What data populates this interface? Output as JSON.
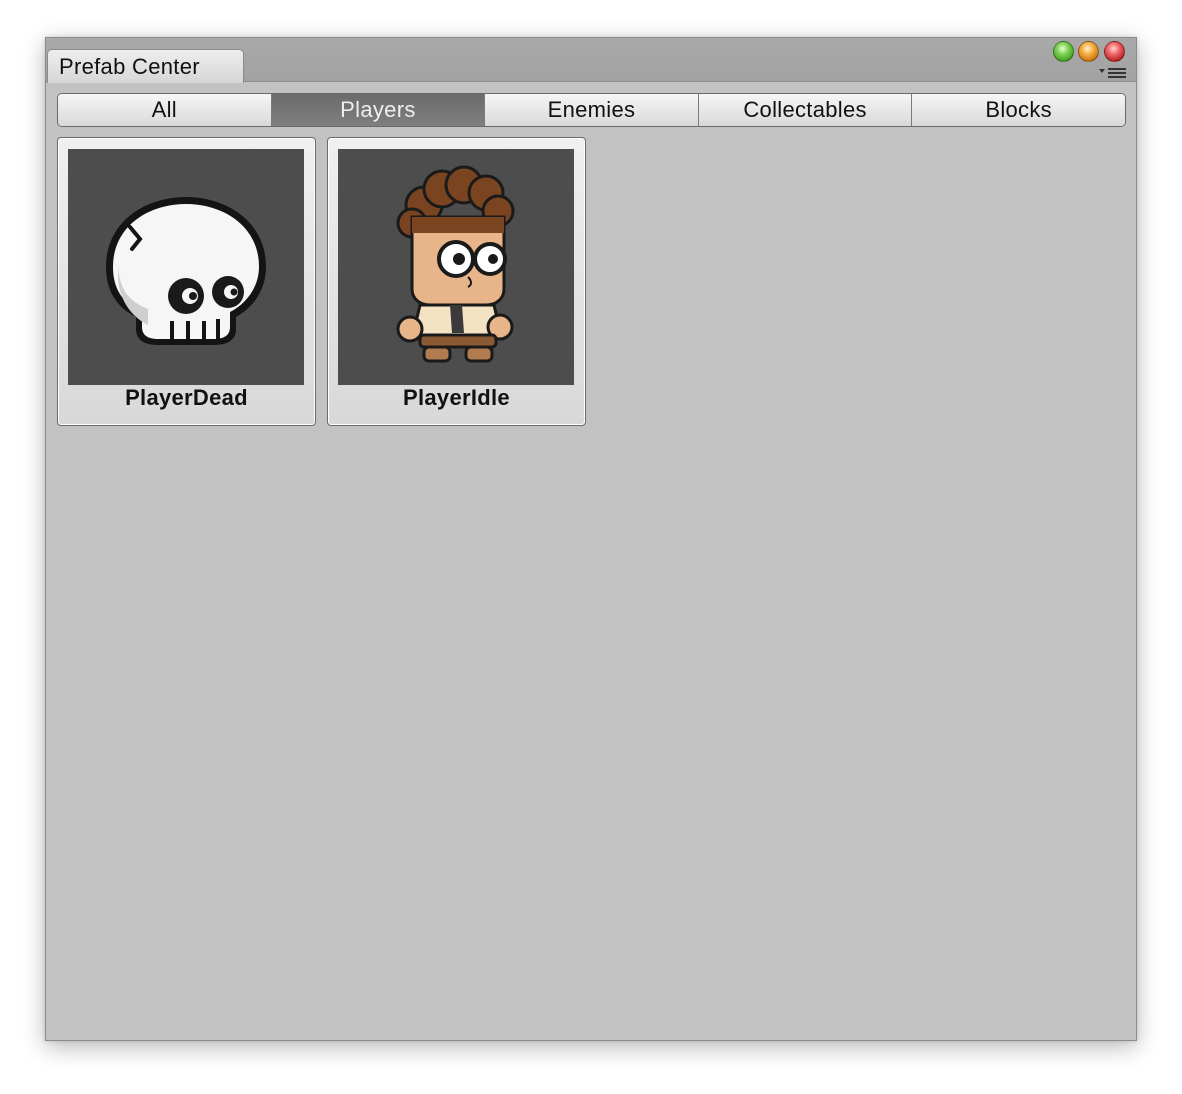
{
  "window": {
    "tab_title": "Prefab Center",
    "controls": [
      "green-zoom",
      "orange-minimize",
      "red-close"
    ],
    "menu_icon": "tab-menu-icon"
  },
  "toolbar": {
    "selected": "Players",
    "buttons": [
      {
        "label": "All",
        "active": false
      },
      {
        "label": "Players",
        "active": true
      },
      {
        "label": "Enemies",
        "active": false
      },
      {
        "label": "Collectables",
        "active": false
      },
      {
        "label": "Blocks",
        "active": false
      }
    ]
  },
  "prefabs": [
    {
      "name": "PlayerDead",
      "icon": "skull-icon"
    },
    {
      "name": "PlayerIdle",
      "icon": "player-character-icon"
    }
  ],
  "colors": {
    "window_bg": "#c2c2c2",
    "thumb_bg": "#4d4d4d",
    "active_button": "#747474"
  }
}
